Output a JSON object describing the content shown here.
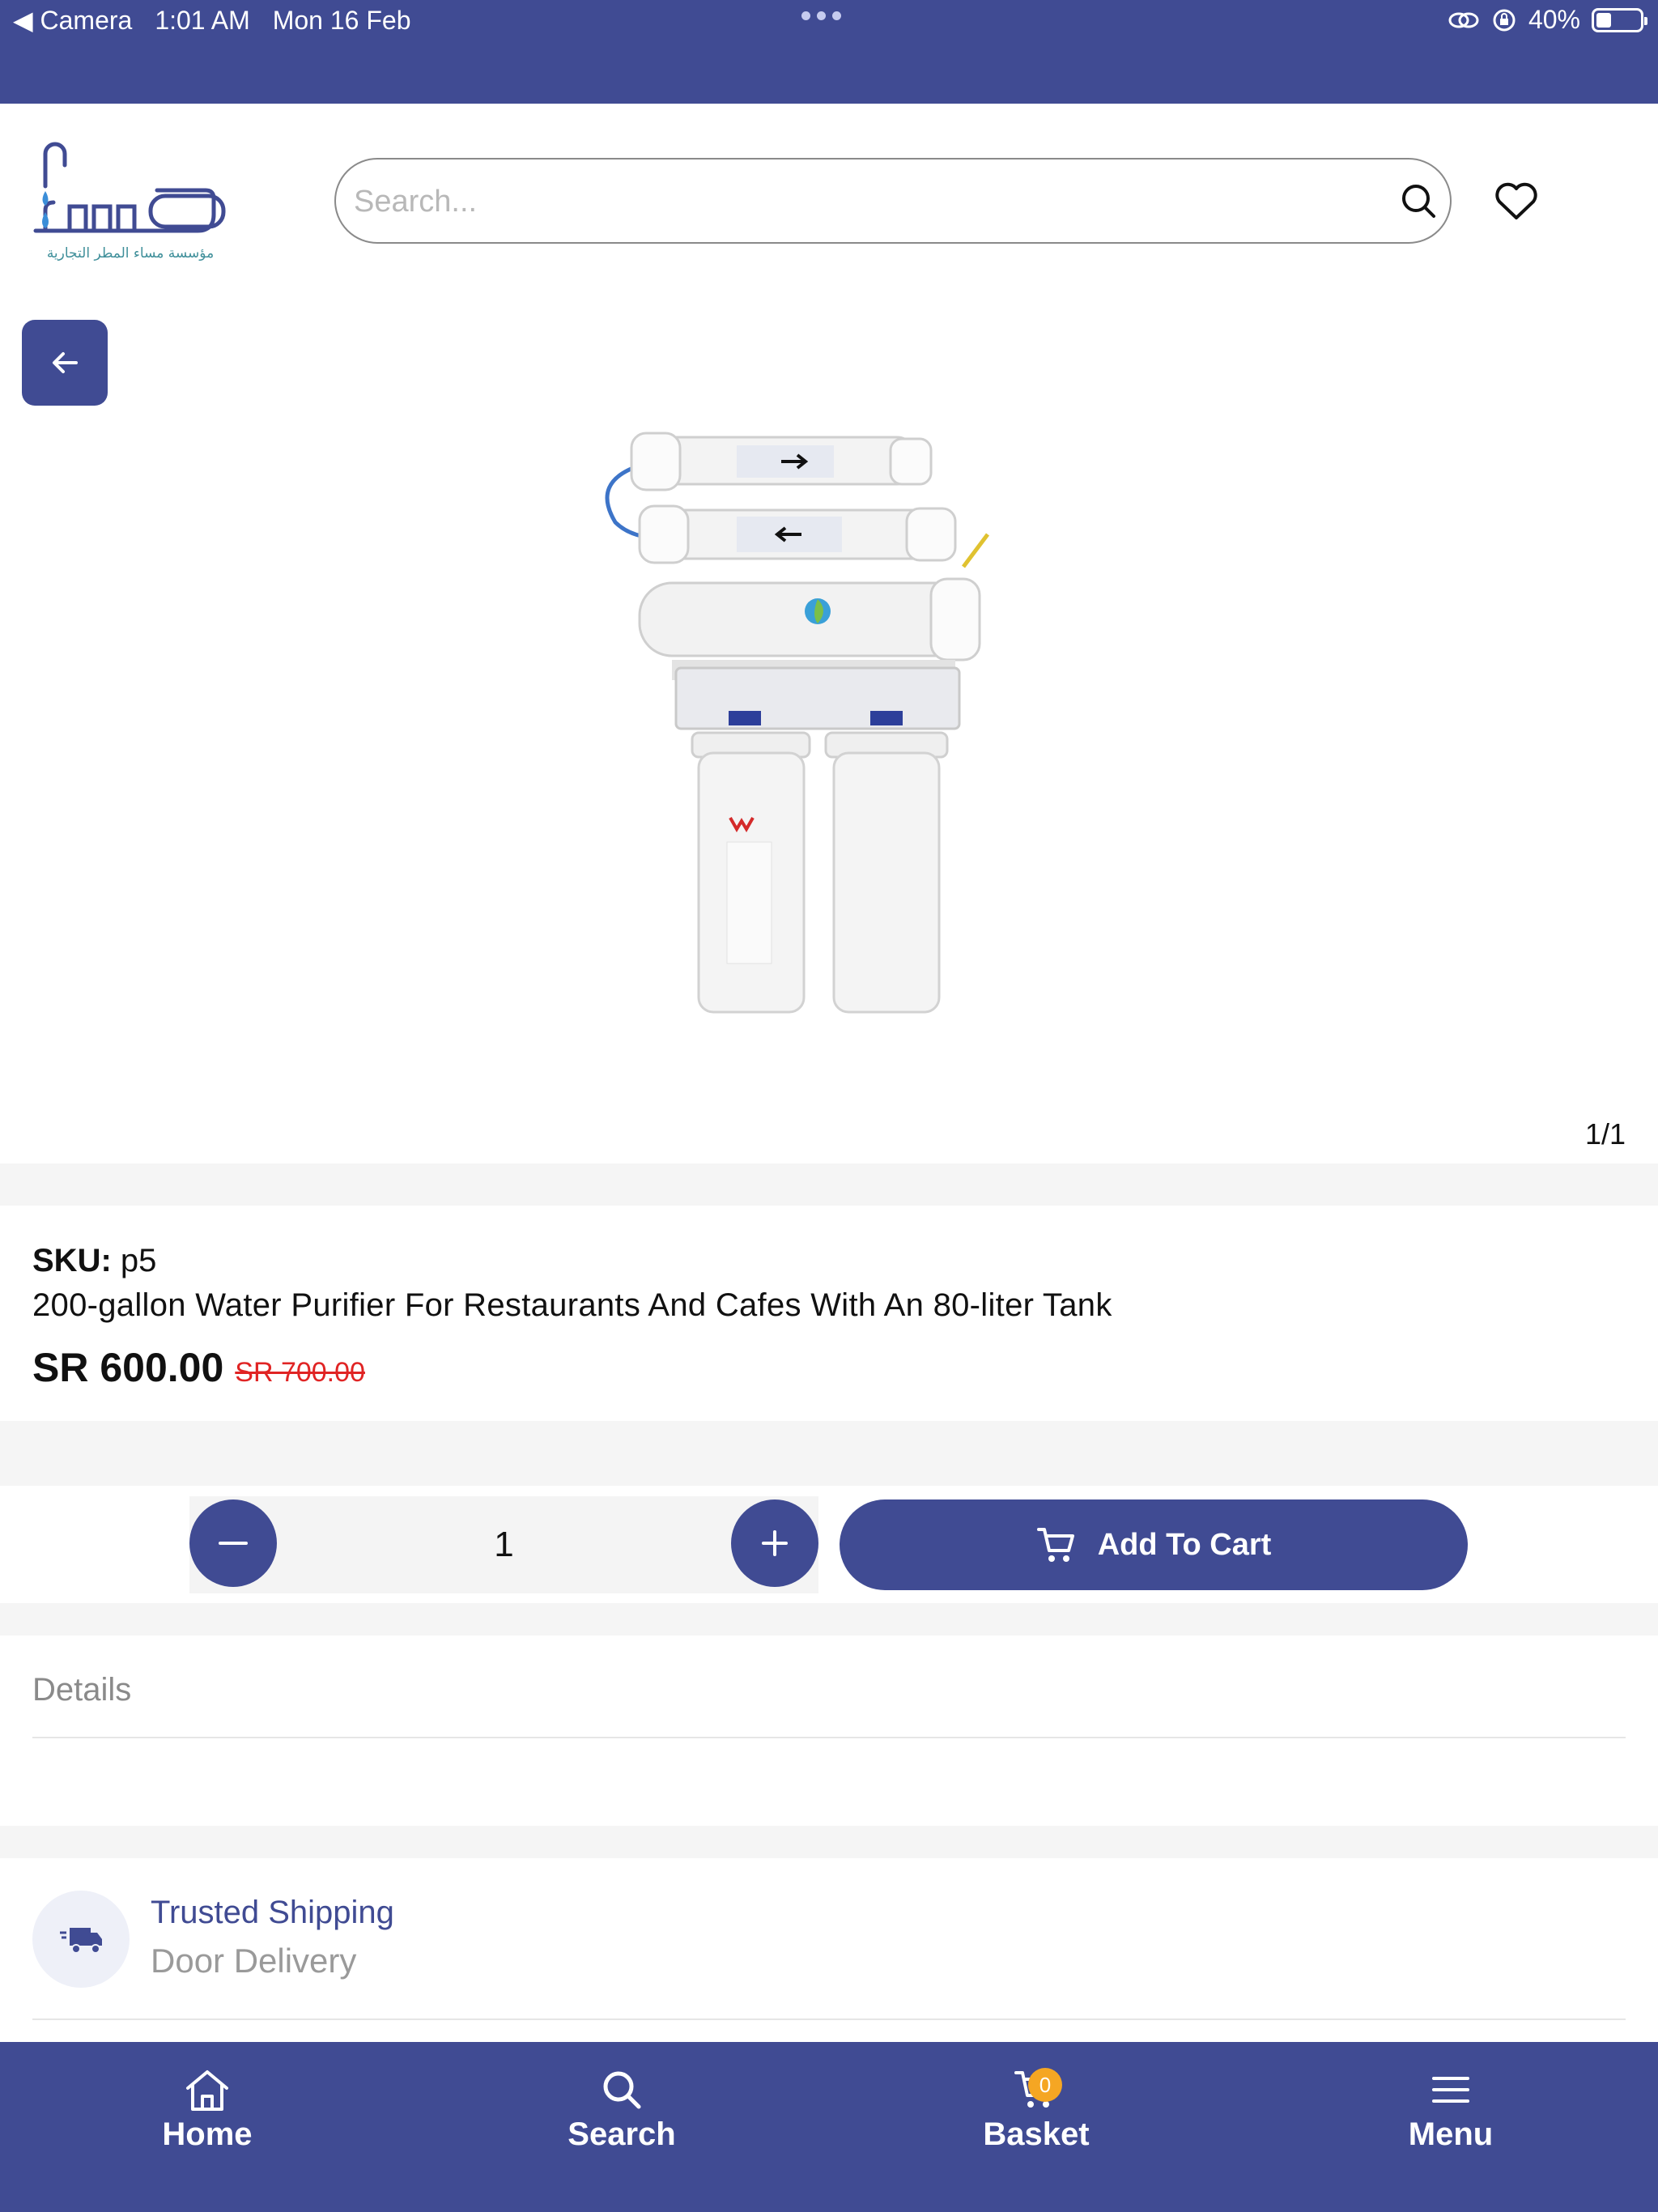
{
  "status_bar": {
    "back_app": "◀ Camera",
    "time": "1:01 AM",
    "date": "Mon 16 Feb",
    "battery": "40%"
  },
  "header": {
    "logo_text_ar": "مؤسسة مساء المطر التجارية",
    "search": {
      "placeholder": "Search...",
      "value": ""
    }
  },
  "gallery": {
    "counter": "1/1"
  },
  "product": {
    "sku_label": "SKU:",
    "sku_value": "p5",
    "title": "200-gallon Water Purifier For Restaurants And Cafes With An 80-liter Tank",
    "price": "SR 600.00",
    "old_price": "SR 700.00"
  },
  "purchase": {
    "quantity": "1",
    "add_to_cart_label": "Add To Cart"
  },
  "tabs": {
    "details_label": "Details"
  },
  "shipping": {
    "line1": "Trusted Shipping",
    "line2": "Door Delivery"
  },
  "bottom_nav": {
    "items": [
      {
        "label": "Home",
        "icon": "home-icon"
      },
      {
        "label": "Search",
        "icon": "search-icon"
      },
      {
        "label": "Basket",
        "icon": "cart-icon",
        "badge": "0"
      },
      {
        "label": "Menu",
        "icon": "menu-icon"
      }
    ]
  },
  "colors": {
    "brand": "#404b93",
    "price_old": "#e02424",
    "badge": "#f5a623"
  }
}
